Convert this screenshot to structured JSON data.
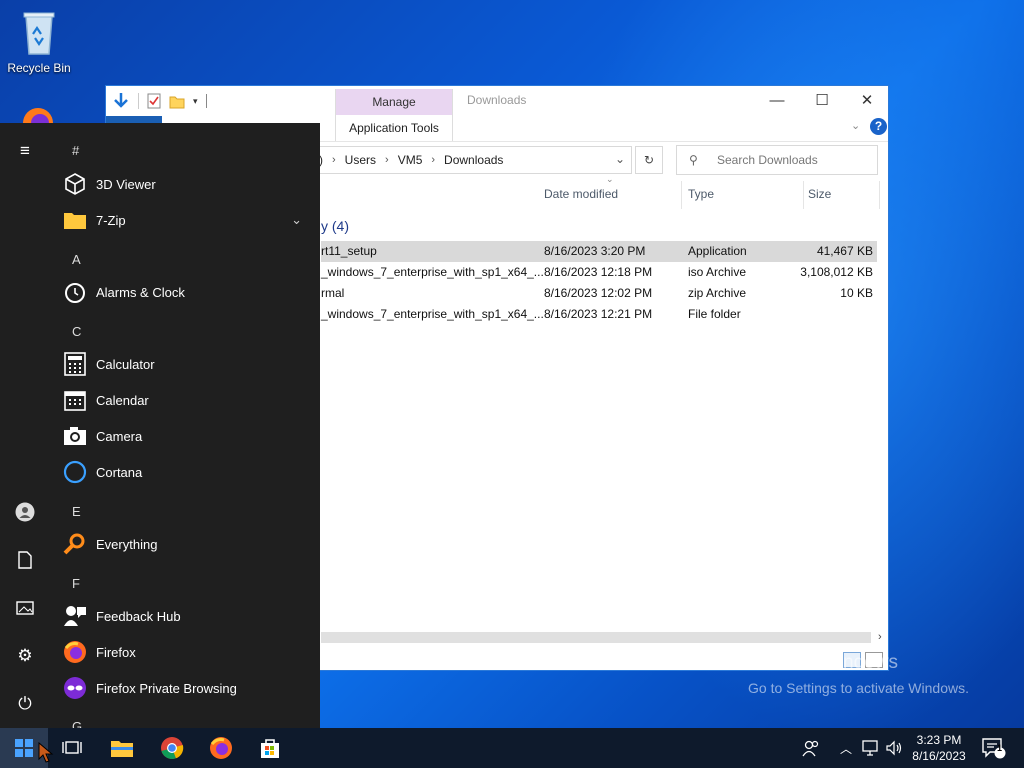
{
  "desktop": {
    "recycle_bin_label": "Recycle Bin",
    "watermark_line1": "Activate Windows",
    "watermark_line2": "Go to Settings to activate Windows."
  },
  "explorer": {
    "title": "Downloads",
    "context_tab_group": "Manage",
    "context_tab": "Application Tools",
    "breadcrumb": [
      ")",
      "Users",
      "VM5",
      "Downloads"
    ],
    "search_placeholder": "Search Downloads",
    "columns": {
      "date": "Date modified",
      "type": "Type",
      "size": "Size"
    },
    "group_header": "y (4)",
    "rows": [
      {
        "name": "rt11_setup",
        "date": "8/16/2023 3:20 PM",
        "type": "Application",
        "size": "41,467 KB",
        "selected": true
      },
      {
        "name": "_windows_7_enterprise_with_sp1_x64_...",
        "date": "8/16/2023 12:18 PM",
        "type": "iso Archive",
        "size": "3,108,012 KB"
      },
      {
        "name": "rmal",
        "date": "8/16/2023 12:02 PM",
        "type": "zip Archive",
        "size": "10 KB"
      },
      {
        "name": "_windows_7_enterprise_with_sp1_x64_...",
        "date": "8/16/2023 12:21 PM",
        "type": "File folder",
        "size": ""
      }
    ]
  },
  "start_menu": {
    "sections": [
      {
        "letter": "#",
        "apps": [
          "3D Viewer",
          "7-Zip"
        ]
      },
      {
        "letter": "A",
        "apps": [
          "Alarms & Clock"
        ]
      },
      {
        "letter": "C",
        "apps": [
          "Calculator",
          "Calendar",
          "Camera",
          "Cortana"
        ]
      },
      {
        "letter": "E",
        "apps": [
          "Everything"
        ]
      },
      {
        "letter": "F",
        "apps": [
          "Feedback Hub",
          "Firefox",
          "Firefox Private Browsing"
        ]
      },
      {
        "letter": "G",
        "apps": []
      }
    ]
  },
  "taskbar": {
    "time": "3:23 PM",
    "date": "8/16/2023",
    "notification_count": "1"
  },
  "colors": {
    "context_tab": "#e9d6f1",
    "start_bg": "#1f1f1f",
    "taskbar_bg": "#0e1a2c",
    "accent": "#0a59d4"
  }
}
